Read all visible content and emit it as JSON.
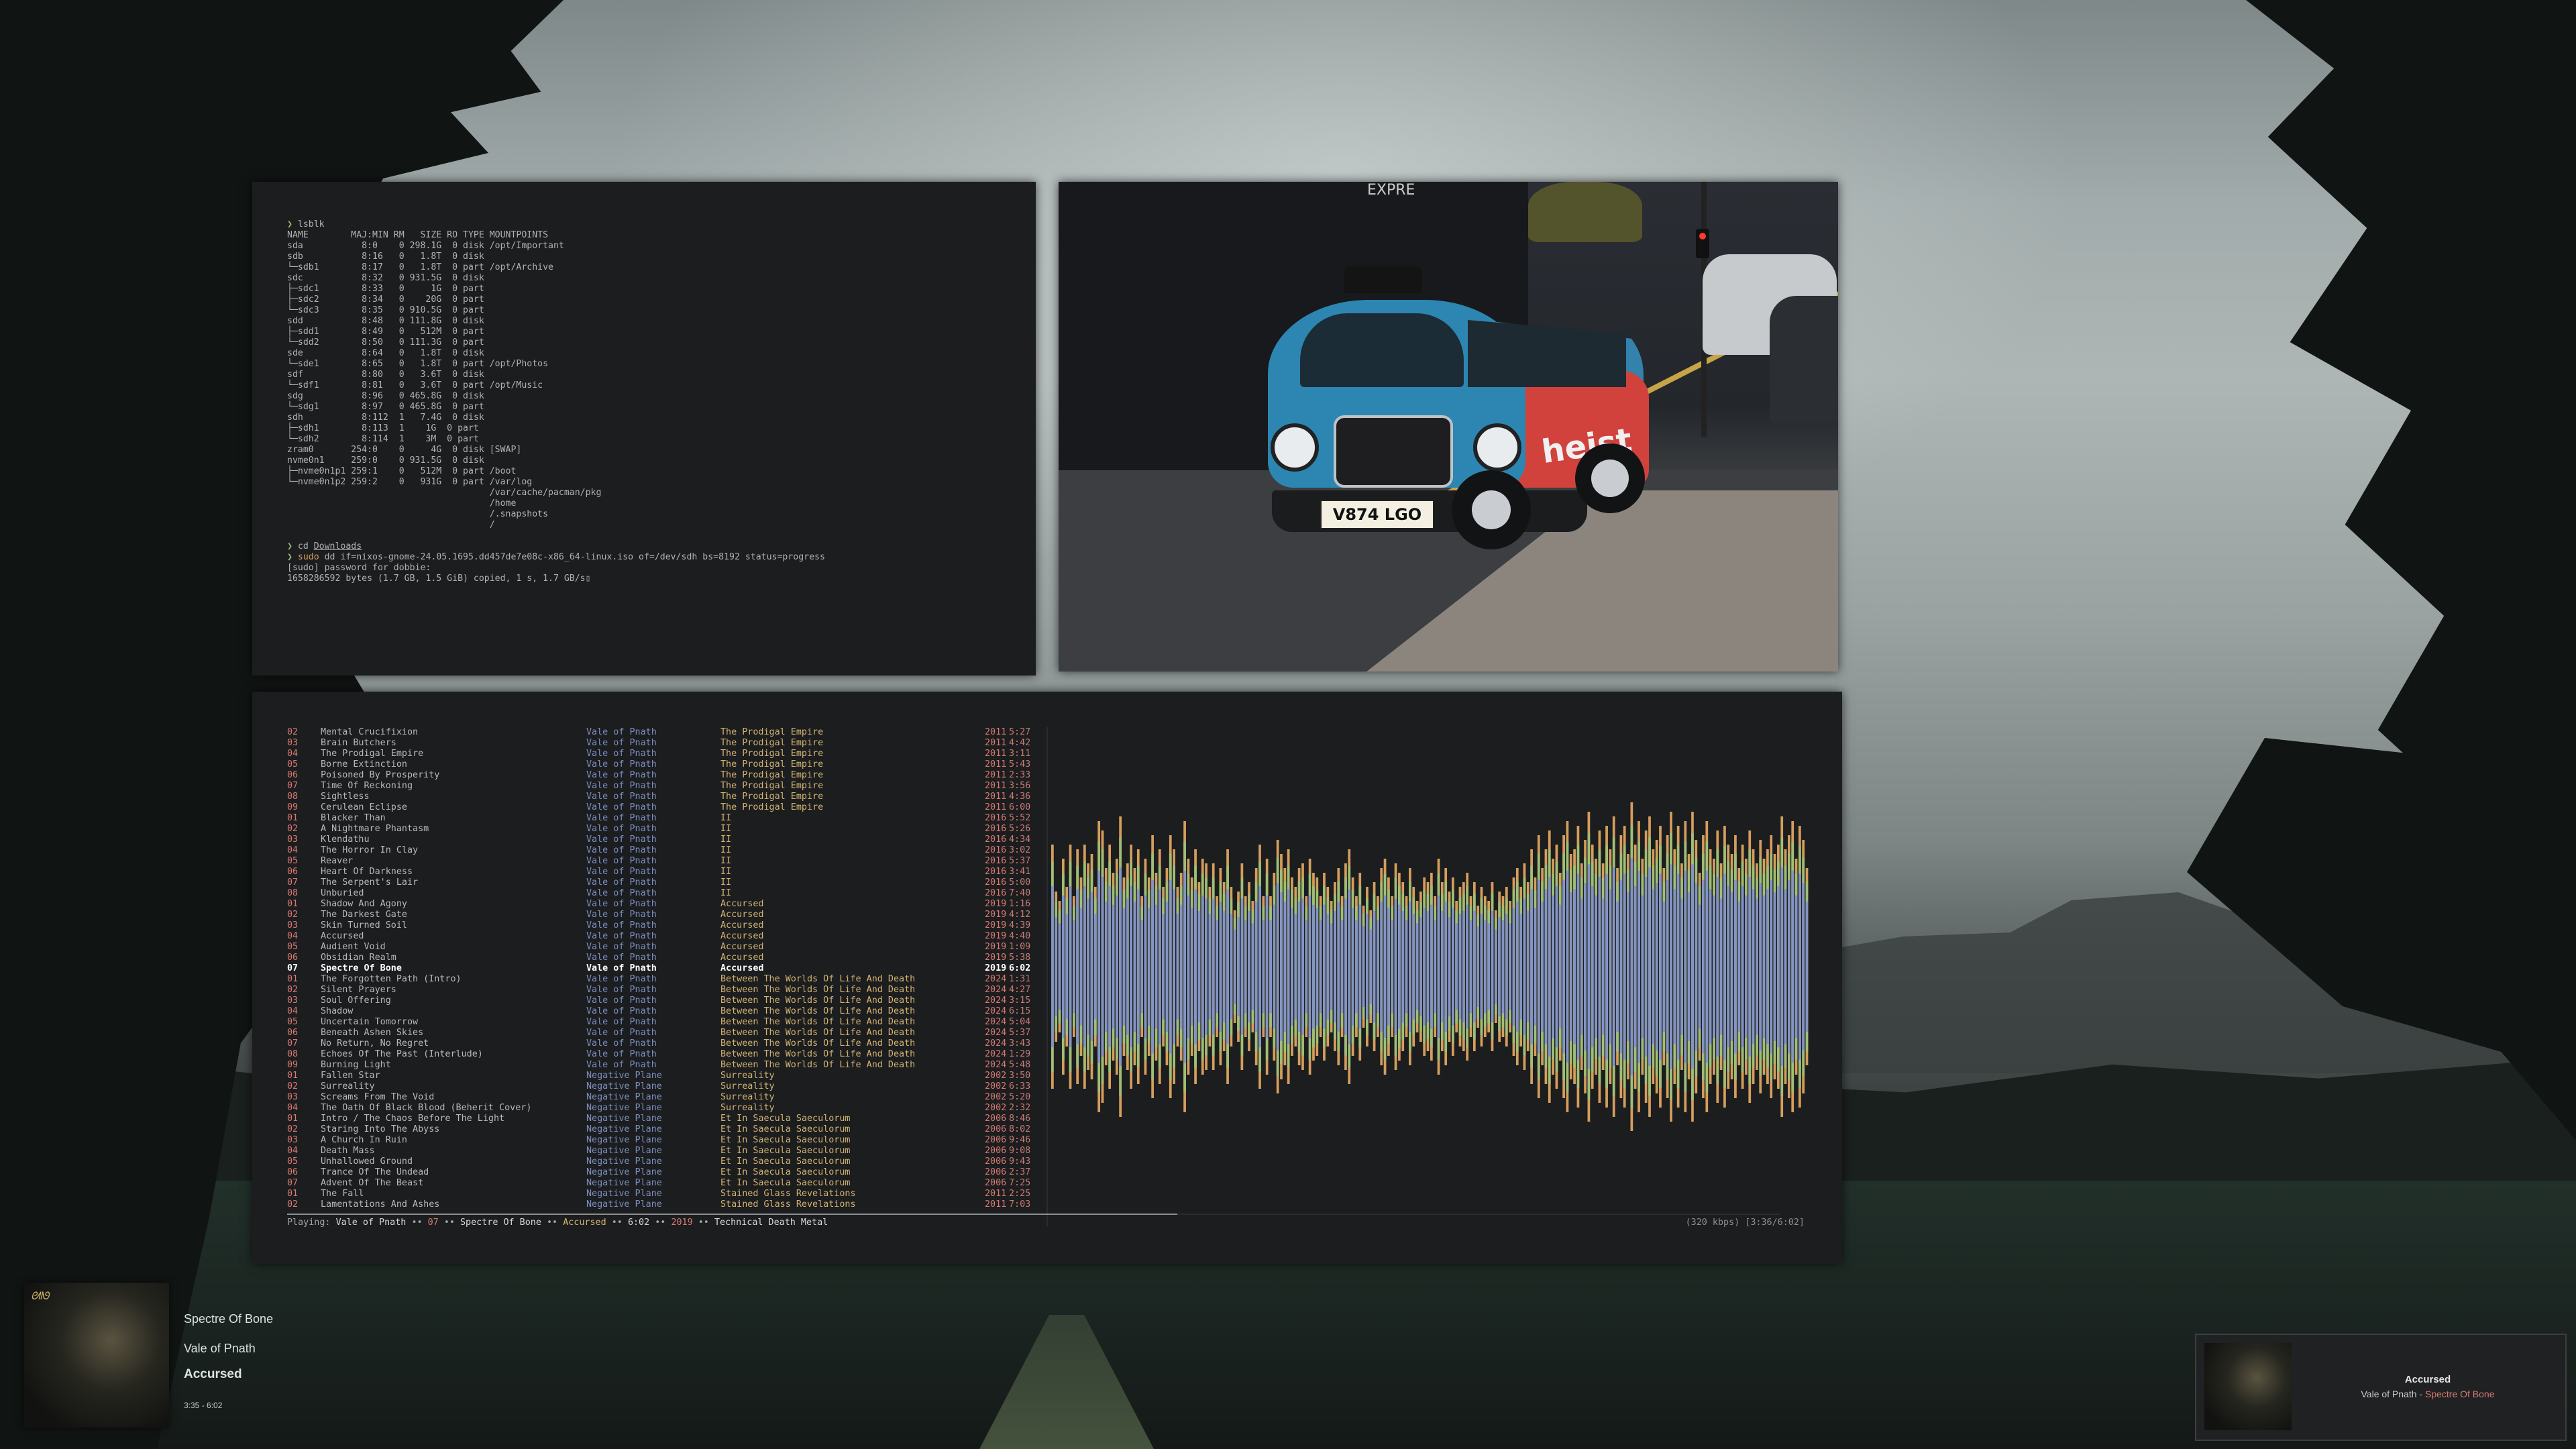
{
  "wallpaper": "misty forest with dark trees",
  "terminal": {
    "lines": [
      [
        [
          "p",
          "❯ "
        ],
        [
          "t",
          "lsblk"
        ]
      ],
      [
        [
          "t",
          "NAME        MAJ:MIN RM   SIZE RO TYPE MOUNTPOINTS"
        ]
      ],
      [
        [
          "t",
          "sda           8:0    0 298.1G  0 disk /opt/Important"
        ]
      ],
      [
        [
          "t",
          "sdb           8:16   0   1.8T  0 disk"
        ]
      ],
      [
        [
          "t",
          "└─sdb1        8:17   0   1.8T  0 part /opt/Archive"
        ]
      ],
      [
        [
          "t",
          "sdc           8:32   0 931.5G  0 disk"
        ]
      ],
      [
        [
          "t",
          "├─sdc1        8:33   0     1G  0 part"
        ]
      ],
      [
        [
          "t",
          "├─sdc2        8:34   0    20G  0 part"
        ]
      ],
      [
        [
          "t",
          "└─sdc3        8:35   0 910.5G  0 part"
        ]
      ],
      [
        [
          "t",
          "sdd           8:48   0 111.8G  0 disk"
        ]
      ],
      [
        [
          "t",
          "├─sdd1        8:49   0   512M  0 part"
        ]
      ],
      [
        [
          "t",
          "└─sdd2        8:50   0 111.3G  0 part"
        ]
      ],
      [
        [
          "t",
          "sde           8:64   0   1.8T  0 disk"
        ]
      ],
      [
        [
          "t",
          "└─sde1        8:65   0   1.8T  0 part /opt/Photos"
        ]
      ],
      [
        [
          "t",
          "sdf           8:80   0   3.6T  0 disk"
        ]
      ],
      [
        [
          "t",
          "└─sdf1        8:81   0   3.6T  0 part /opt/Music"
        ]
      ],
      [
        [
          "t",
          "sdg           8:96   0 465.8G  0 disk"
        ]
      ],
      [
        [
          "t",
          "└─sdg1        8:97   0 465.8G  0 part"
        ]
      ],
      [
        [
          "t",
          "sdh           8:112  1   7.4G  0 disk"
        ]
      ],
      [
        [
          "t",
          "├─sdh1        8:113  1    1G  0 part"
        ]
      ],
      [
        [
          "t",
          "└─sdh2        8:114  1    3M  0 part"
        ]
      ],
      [
        [
          "t",
          "zram0       254:0    0     4G  0 disk [SWAP]"
        ]
      ],
      [
        [
          "t",
          "nvme0n1     259:0    0 931.5G  0 disk"
        ]
      ],
      [
        [
          "t",
          "├─nvme0n1p1 259:1    0   512M  0 part /boot"
        ]
      ],
      [
        [
          "t",
          "└─nvme0n1p2 259:2    0   931G  0 part /var/log"
        ]
      ],
      [
        [
          "t",
          "                                      /var/cache/pacman/pkg"
        ]
      ],
      [
        [
          "t",
          "                                      /home"
        ]
      ],
      [
        [
          "t",
          "                                      /.snapshots"
        ]
      ],
      [
        [
          "t",
          "                                      /"
        ]
      ],
      [
        [
          "t",
          ""
        ]
      ],
      [
        [
          "p",
          "❯ "
        ],
        [
          "t",
          "cd "
        ],
        [
          "u",
          "Downloads"
        ]
      ],
      [
        [
          "p",
          "❯ "
        ],
        [
          "s",
          "sudo"
        ],
        [
          "t",
          " dd if=nixos-gnome-24.05.1695.dd457de7e08c-x86_64-linux.iso of=/dev/sdh bs=8192 status=progress"
        ]
      ],
      [
        [
          "t",
          "[sudo] password for dobbie:"
        ]
      ],
      [
        [
          "t",
          "1658286592 bytes (1.7 GB, 1.5 GiB) copied, 1 s, 1.7 GB/s▯"
        ]
      ]
    ]
  },
  "photo": {
    "plate": "V874 LGO",
    "ad_text": "heist",
    "banner": "EXPRE"
  },
  "player": {
    "tracks": [
      [
        "02",
        "Mental Crucifixion",
        "Vale of Pnath",
        "The Prodigal Empire",
        "2011",
        "5:27"
      ],
      [
        "03",
        "Brain Butchers",
        "Vale of Pnath",
        "The Prodigal Empire",
        "2011",
        "4:42"
      ],
      [
        "04",
        "The Prodigal Empire",
        "Vale of Pnath",
        "The Prodigal Empire",
        "2011",
        "3:11"
      ],
      [
        "05",
        "Borne Extinction",
        "Vale of Pnath",
        "The Prodigal Empire",
        "2011",
        "5:43"
      ],
      [
        "06",
        "Poisoned By Prosperity",
        "Vale of Pnath",
        "The Prodigal Empire",
        "2011",
        "2:33"
      ],
      [
        "07",
        "Time Of Reckoning",
        "Vale of Pnath",
        "The Prodigal Empire",
        "2011",
        "3:56"
      ],
      [
        "08",
        "Sightless",
        "Vale of Pnath",
        "The Prodigal Empire",
        "2011",
        "4:36"
      ],
      [
        "09",
        "Cerulean Eclipse",
        "Vale of Pnath",
        "The Prodigal Empire",
        "2011",
        "6:00"
      ],
      [
        "01",
        "Blacker Than",
        "Vale of Pnath",
        "II",
        "2016",
        "5:52"
      ],
      [
        "02",
        "A Nightmare Phantasm",
        "Vale of Pnath",
        "II",
        "2016",
        "5:26"
      ],
      [
        "03",
        "Klendathu",
        "Vale of Pnath",
        "II",
        "2016",
        "4:34"
      ],
      [
        "04",
        "The Horror In Clay",
        "Vale of Pnath",
        "II",
        "2016",
        "3:02"
      ],
      [
        "05",
        "Reaver",
        "Vale of Pnath",
        "II",
        "2016",
        "5:37"
      ],
      [
        "06",
        "Heart Of Darkness",
        "Vale of Pnath",
        "II",
        "2016",
        "3:41"
      ],
      [
        "07",
        "The Serpent's Lair",
        "Vale of Pnath",
        "II",
        "2016",
        "5:00"
      ],
      [
        "08",
        "Unburied",
        "Vale of Pnath",
        "II",
        "2016",
        "7:40"
      ],
      [
        "01",
        "Shadow And Agony",
        "Vale of Pnath",
        "Accursed",
        "2019",
        "1:16"
      ],
      [
        "02",
        "The Darkest Gate",
        "Vale of Pnath",
        "Accursed",
        "2019",
        "4:12"
      ],
      [
        "03",
        "Skin Turned Soil",
        "Vale of Pnath",
        "Accursed",
        "2019",
        "4:39"
      ],
      [
        "04",
        "Accursed",
        "Vale of Pnath",
        "Accursed",
        "2019",
        "4:40"
      ],
      [
        "05",
        "Audient Void",
        "Vale of Pnath",
        "Accursed",
        "2019",
        "1:09"
      ],
      [
        "06",
        "Obsidian Realm",
        "Vale of Pnath",
        "Accursed",
        "2019",
        "5:38"
      ],
      [
        "07",
        "Spectre Of Bone",
        "Vale of Pnath",
        "Accursed",
        "2019",
        "6:02"
      ],
      [
        "01",
        "The Forgotten Path (Intro)",
        "Vale of Pnath",
        "Between The Worlds Of Life And Death",
        "2024",
        "1:31"
      ],
      [
        "02",
        "Silent Prayers",
        "Vale of Pnath",
        "Between The Worlds Of Life And Death",
        "2024",
        "4:27"
      ],
      [
        "03",
        "Soul Offering",
        "Vale of Pnath",
        "Between The Worlds Of Life And Death",
        "2024",
        "3:15"
      ],
      [
        "04",
        "Shadow",
        "Vale of Pnath",
        "Between The Worlds Of Life And Death",
        "2024",
        "6:15"
      ],
      [
        "05",
        "Uncertain Tomorrow",
        "Vale of Pnath",
        "Between The Worlds Of Life And Death",
        "2024",
        "5:04"
      ],
      [
        "06",
        "Beneath Ashen Skies",
        "Vale of Pnath",
        "Between The Worlds Of Life And Death",
        "2024",
        "5:37"
      ],
      [
        "07",
        "No Return, No Regret",
        "Vale of Pnath",
        "Between The Worlds Of Life And Death",
        "2024",
        "3:43"
      ],
      [
        "08",
        "Echoes Of The Past (Interlude)",
        "Vale of Pnath",
        "Between The Worlds Of Life And Death",
        "2024",
        "1:29"
      ],
      [
        "09",
        "Burning Light",
        "Vale of Pnath",
        "Between The Worlds Of Life And Death",
        "2024",
        "5:48"
      ],
      [
        "01",
        "Fallen Star",
        "Negative Plane",
        "Surreality",
        "2002",
        "3:50"
      ],
      [
        "02",
        "Surreality",
        "Negative Plane",
        "Surreality",
        "2002",
        "6:33"
      ],
      [
        "03",
        "Screams From The Void",
        "Negative Plane",
        "Surreality",
        "2002",
        "5:20"
      ],
      [
        "04",
        "The Oath Of Black Blood (Beherit Cover)",
        "Negative Plane",
        "Surreality",
        "2002",
        "2:32"
      ],
      [
        "01",
        "Intro / The Chaos Before The Light",
        "Negative Plane",
        "Et In Saecula Saeculorum",
        "2006",
        "8:46"
      ],
      [
        "02",
        "Staring Into The Abyss",
        "Negative Plane",
        "Et In Saecula Saeculorum",
        "2006",
        "8:02"
      ],
      [
        "03",
        "A Church In Ruin",
        "Negative Plane",
        "Et In Saecula Saeculorum",
        "2006",
        "9:46"
      ],
      [
        "04",
        "Death Mass",
        "Negative Plane",
        "Et In Saecula Saeculorum",
        "2006",
        "9:08"
      ],
      [
        "05",
        "Unhallowed Ground",
        "Negative Plane",
        "Et In Saecula Saeculorum",
        "2006",
        "9:43"
      ],
      [
        "06",
        "Trance Of The Undead",
        "Negative Plane",
        "Et In Saecula Saeculorum",
        "2006",
        "2:37"
      ],
      [
        "07",
        "Advent Of The Beast",
        "Negative Plane",
        "Et In Saecula Saeculorum",
        "2006",
        "7:25"
      ],
      [
        "01",
        "The Fall",
        "Negative Plane",
        "Stained Glass Revelations",
        "2011",
        "2:25"
      ],
      [
        "02",
        "Lamentations And Ashes",
        "Negative Plane",
        "Stained Glass Revelations",
        "2011",
        "7:03"
      ]
    ],
    "current_index": 22,
    "status": {
      "label": "Playing:",
      "artist": "Vale of Pnath",
      "sep": "••",
      "num": "07",
      "title": "Spectre Of Bone",
      "album": "Accursed",
      "length": "6:02",
      "year": "2019",
      "genre": "Technical Death Metal",
      "bitrate": "(320 kbps) [3:36/6:02]"
    },
    "progress": 0.596,
    "visualizer": {
      "colors": {
        "base": "#8394c4",
        "mid": "#9fbf76",
        "top": "#d59e5c"
      },
      "levels": [
        0.52,
        0.32,
        0.28,
        0.46,
        0.34,
        0.52,
        0.3,
        0.5,
        0.38,
        0.52,
        0.44,
        0.48,
        0.34,
        0.62,
        0.58,
        0.42,
        0.52,
        0.4,
        0.46,
        0.64,
        0.38,
        0.44,
        0.52,
        0.42,
        0.5,
        0.3,
        0.46,
        0.38,
        0.56,
        0.4,
        0.5,
        0.34,
        0.42,
        0.56,
        0.5,
        0.34,
        0.4,
        0.62,
        0.46,
        0.38,
        0.5,
        0.36,
        0.46,
        0.44,
        0.34,
        0.44,
        0.3,
        0.42,
        0.36,
        0.5,
        0.34,
        0.24,
        0.32,
        0.44,
        0.3,
        0.36,
        0.28,
        0.42,
        0.52,
        0.3,
        0.46,
        0.3,
        0.4,
        0.54,
        0.48,
        0.42,
        0.5,
        0.38,
        0.34,
        0.42,
        0.44,
        0.3,
        0.46,
        0.4,
        0.38,
        0.3,
        0.4,
        0.34,
        0.28,
        0.36,
        0.42,
        0.3,
        0.44,
        0.5,
        0.38,
        0.3,
        0.4,
        0.26,
        0.34,
        0.24,
        0.36,
        0.3,
        0.42,
        0.46,
        0.38,
        0.3,
        0.44,
        0.4,
        0.36,
        0.3,
        0.42,
        0.34,
        0.28,
        0.32,
        0.38,
        0.36,
        0.4,
        0.3,
        0.46,
        0.36,
        0.42,
        0.32,
        0.38,
        0.28,
        0.34,
        0.36,
        0.4,
        0.3,
        0.36,
        0.26,
        0.34,
        0.3,
        0.28,
        0.36,
        0.24,
        0.32,
        0.3,
        0.34,
        0.28,
        0.38,
        0.42,
        0.34,
        0.44,
        0.36,
        0.5,
        0.38,
        0.56,
        0.42,
        0.5,
        0.58,
        0.46,
        0.52,
        0.4,
        0.56,
        0.62,
        0.48,
        0.5,
        0.6,
        0.44,
        0.54,
        0.66,
        0.52,
        0.46,
        0.58,
        0.44,
        0.6,
        0.5,
        0.64,
        0.42,
        0.56,
        0.6,
        0.48,
        0.7,
        0.52,
        0.62,
        0.46,
        0.58,
        0.64,
        0.5,
        0.54,
        0.6,
        0.42,
        0.56,
        0.66,
        0.5,
        0.6,
        0.44,
        0.62,
        0.48,
        0.66,
        0.54,
        0.4,
        0.56,
        0.62,
        0.5,
        0.46,
        0.58,
        0.44,
        0.6,
        0.52,
        0.48,
        0.56,
        0.42,
        0.52,
        0.46,
        0.58,
        0.5,
        0.44,
        0.54,
        0.46,
        0.5,
        0.56,
        0.48,
        0.52,
        0.64,
        0.5,
        0.56,
        0.62,
        0.46,
        0.6,
        0.54,
        0.42
      ]
    }
  },
  "now_playing": {
    "title": "Spectre Of Bone",
    "artist": "Vale of Pnath",
    "album": "Accursed",
    "time": "3:35 - 6:02"
  },
  "notification": {
    "title": "Accursed",
    "artist": "Vale of Pnath",
    "dash": " - ",
    "track": "Spectre Of Bone"
  }
}
